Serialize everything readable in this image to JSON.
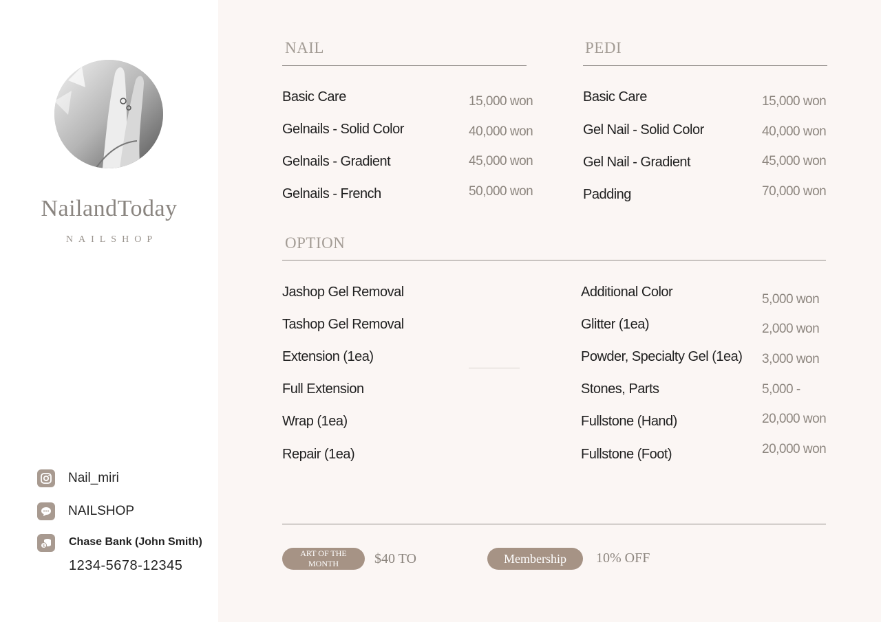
{
  "brand": {
    "name": "NailandToday",
    "subtitle": "NAILSHOP"
  },
  "contacts": {
    "instagram": {
      "icon": "instagram-icon",
      "label": "Nail_miri"
    },
    "chat": {
      "icon": "chat-icon",
      "label": "NAILSHOP"
    },
    "bank": {
      "icon": "bank-icon",
      "name": "Chase Bank (John Smith)",
      "number": "1234-5678-12345"
    }
  },
  "nail": {
    "title": "NAIL",
    "items": [
      {
        "name": "Basic Care",
        "price": "15,000 won"
      },
      {
        "name": "Gelnails - Solid Color",
        "price": "40,000 won"
      },
      {
        "name": "Gelnails - Gradient",
        "price": "45,000 won"
      },
      {
        "name": "Gelnails - French",
        "price": "50,000 won"
      }
    ]
  },
  "pedi": {
    "title": "PEDI",
    "items": [
      {
        "name": "Basic Care",
        "price": "15,000 won"
      },
      {
        "name": "Gel Nail - Solid Color",
        "price": "40,000 won"
      },
      {
        "name": "Gel Nail - Gradient",
        "price": "45,000 won"
      },
      {
        "name": "Padding",
        "price": "70,000 won"
      }
    ]
  },
  "option": {
    "title": "OPTION",
    "left": [
      "Jashop Gel Removal",
      "Tashop Gel Removal",
      "Extension (1ea)",
      "Full Extension",
      "Wrap (1ea)",
      "Repair (1ea)"
    ],
    "right": [
      {
        "name": "Additional Color",
        "price": "5,000 won"
      },
      {
        "name": "Glitter (1ea)",
        "price": "2,000 won"
      },
      {
        "name": "Powder, Specialty Gel (1ea)",
        "price": "3,000 won"
      },
      {
        "name": "Stones, Parts",
        "price": "5,000 -"
      },
      {
        "name": "Fullstone (Hand)",
        "price": "20,000 won"
      },
      {
        "name": "Fullstone (Foot)",
        "price": "20,000 won"
      }
    ]
  },
  "promo": {
    "art_label_line1": "ART OF THE",
    "art_label_line2": "MONTH",
    "art_value": "$40 TO",
    "membership_label": "Membership",
    "membership_value": "10% OFF"
  },
  "colors": {
    "accent": "#a69385",
    "background": "#fbf6f4",
    "muted_text": "#8c857e"
  }
}
